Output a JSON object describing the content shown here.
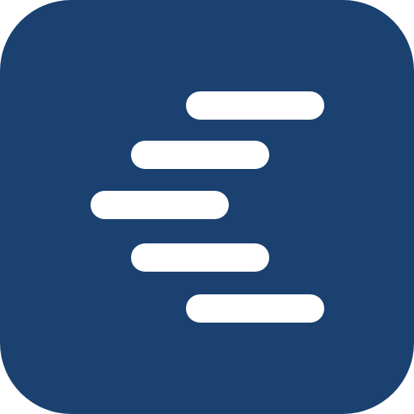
{
  "icon": {
    "name": "app-logo-icon",
    "colors": {
      "background": "#ffffff",
      "tile": "#1a4170",
      "bars": "#ffffff"
    }
  }
}
